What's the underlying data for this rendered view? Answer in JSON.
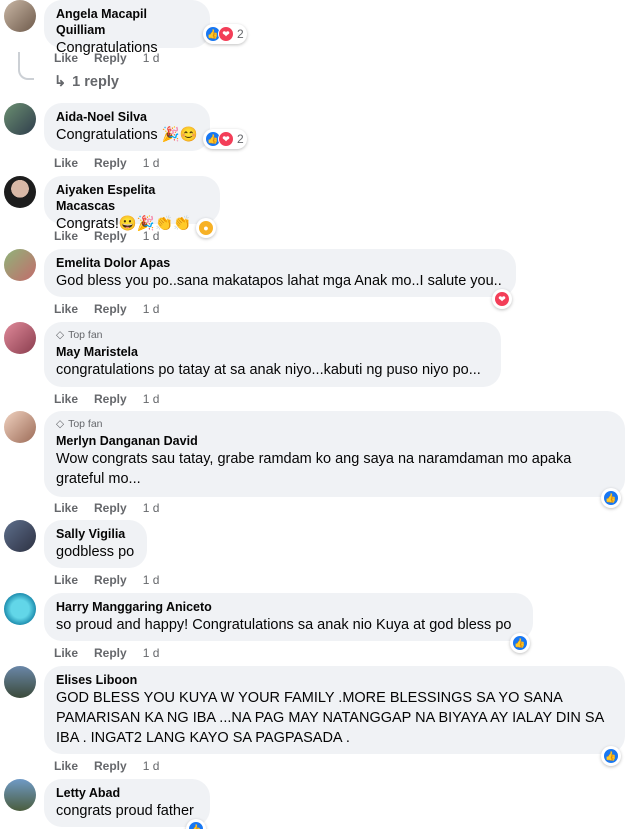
{
  "ui": {
    "like_label": "Like",
    "reply_label": "Reply",
    "time": "1 d",
    "topfan_label": "Top fan"
  },
  "comments": [
    {
      "author": "Angela Macapil Quilliam",
      "text": "Congratulations",
      "react_count": "2"
    },
    {
      "author": "Aida-Noel Silva",
      "text": "Congratulations 🎉😊",
      "react_count": "2"
    },
    {
      "author": "Aiyaken Espelita Macascas",
      "text": "Congrats!😀🎉👏👏"
    },
    {
      "author": "Emelita Dolor Apas",
      "text": "God bless you po..sana makatapos lahat mga Anak mo..I salute you.."
    },
    {
      "author": "May Maristela",
      "text": "congratulations po tatay at sa anak niyo...kabuti ng puso niyo po..."
    },
    {
      "author": "Merlyn Danganan David",
      "text_line1": "Wow congrats sau tatay, grabe ramdam ko ang saya na naramdaman mo apaka",
      "text_line2": "grateful mo..."
    },
    {
      "author": "Sally Vigilia",
      "text": "godbless po"
    },
    {
      "author": "Harry Manggaring Aniceto",
      "text": "so proud and happy! Congratulations sa anak nio Kuya at god bless po"
    },
    {
      "author": "Elises Liboon",
      "text_line1": "GOD BLESS YOU KUYA W YOUR FAMILY .MORE BLESSINGS SA YO SANA",
      "text_line2": "PAMARISAN KA NG IBA ...NA PAG MAY NATANGGAP NA BIYAYA AY IALAY DIN SA",
      "text_line3": "IBA . INGAT2 LANG KAYO SA PAGPASADA ."
    },
    {
      "author": "Letty Abad",
      "text": "congrats proud father"
    }
  ],
  "replies_link": "1 reply",
  "colors": {
    "bubble": "#f0f2f5",
    "like_blue": "#1877f2",
    "love_red": "#f33e58",
    "meta_gray": "#65676b"
  },
  "icons": {
    "like": "thumbs-up-icon",
    "love": "heart-icon",
    "wow": "wow-face-icon",
    "reply_arrow": "reply-arrow-icon",
    "top_fan": "diamond-icon"
  }
}
